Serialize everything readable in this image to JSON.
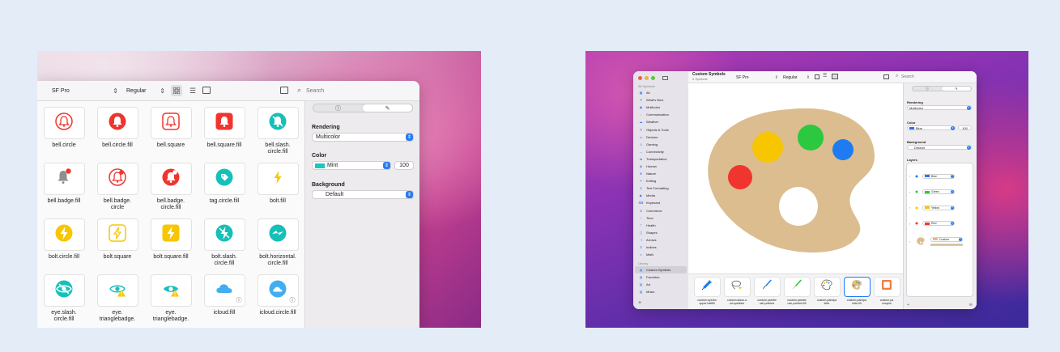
{
  "left_window": {
    "toolbar": {
      "font": "SF Pro",
      "weight": "Regular",
      "search_placeholder": "Search"
    },
    "symbols": [
      {
        "name": "bell.circle",
        "icon": "bell-circle-icon",
        "color": "#f0352e"
      },
      {
        "name": "bell.circle.fill",
        "icon": "bell-circle-fill-icon",
        "color": "#f0352e"
      },
      {
        "name": "bell.square",
        "icon": "bell-square-icon",
        "color": "#f0352e"
      },
      {
        "name": "bell.square.fill",
        "icon": "bell-square-fill-icon",
        "color": "#f0352e"
      },
      {
        "name": "bell.slash.\ncircle.fill",
        "icon": "bell-slash-circle-fill-icon",
        "color": "#16c0b8"
      },
      {
        "name": "bell.badge.fill",
        "icon": "bell-badge-fill-icon",
        "color": "#8e8e93"
      },
      {
        "name": "bell.badge.\ncircle",
        "icon": "bell-badge-circle-icon",
        "color": "#f0352e"
      },
      {
        "name": "bell.badge.\ncircle.fill",
        "icon": "bell-badge-circle-fill-icon",
        "color": "#f0352e"
      },
      {
        "name": "tag.circle.fill",
        "icon": "tag-circle-fill-icon",
        "color": "#16c0b8"
      },
      {
        "name": "bolt.fill",
        "icon": "bolt-fill-icon",
        "color": "#f7c600"
      },
      {
        "name": "bolt.circle.fill",
        "icon": "bolt-circle-fill-icon",
        "color": "#f7c600"
      },
      {
        "name": "bolt.square",
        "icon": "bolt-square-icon",
        "color": "#f7c600"
      },
      {
        "name": "bolt.square.fill",
        "icon": "bolt-square-fill-icon",
        "color": "#f7c600"
      },
      {
        "name": "bolt.slash.\ncircle.fill",
        "icon": "bolt-slash-circle-fill-icon",
        "color": "#16c0b8"
      },
      {
        "name": "bolt.horizontal.\ncircle.fill",
        "icon": "bolt-horizontal-circle-fill-icon",
        "color": "#16c0b8"
      },
      {
        "name": "eye.slash.\ncircle.fill",
        "icon": "eye-slash-circle-fill-icon",
        "color": "#16c0b8"
      },
      {
        "name": "eye.\ntrianglebadge.",
        "icon": "eye-trianglebadge-icon",
        "color": "#16c0b8"
      },
      {
        "name": "eye.\ntrianglebadge.",
        "icon": "eye-trianglebadge-fill-icon",
        "color": "#16c0b8"
      },
      {
        "name": "icloud.fill",
        "icon": "icloud-fill-icon",
        "color": "#42aef0"
      },
      {
        "name": "icloud.circle.fill",
        "icon": "icloud-circle-fill-icon",
        "color": "#42aef0"
      }
    ],
    "inspector": {
      "rendering_label": "Rendering",
      "rendering_value": "Multicolor",
      "color_label": "Color",
      "color_value": "Mint",
      "color_swatch": "#1cc5be",
      "opacity_value": "100",
      "background_label": "Background",
      "background_value": "Default"
    }
  },
  "right_window": {
    "title": "Custom Symbols",
    "subtitle": "6 Symbols",
    "toolbar": {
      "font": "SF Pro",
      "weight": "Regular",
      "search_placeholder": "Search"
    },
    "sidebar": {
      "section1": "All Symbols",
      "items": [
        "All",
        "What's New",
        "Multicolor",
        "Communication",
        "Weather",
        "Objects & Tools",
        "Devices",
        "Gaming",
        "Connectivity",
        "Transportation",
        "Human",
        "Nature",
        "Editing",
        "Text Formatting",
        "Media",
        "Keyboard",
        "Commerce",
        "Time",
        "Health",
        "Shapes",
        "Arrows",
        "Indices",
        "Math"
      ],
      "section2": "Library",
      "library": [
        "Custom Symbols",
        "Favorites",
        "Art",
        "Music"
      ]
    },
    "palette_colors": {
      "body": "#dbbd8f",
      "yellow": "#f7c600",
      "green": "#2cc840",
      "blue": "#1e7bf2",
      "red": "#f0352e"
    },
    "strip": [
      {
        "name": "custom.eyedro\nopper.halffill",
        "icon": "eyedropper-icon"
      },
      {
        "name": "custom.lasso.a\nnd.sparkles",
        "icon": "lasso-sparkles-icon"
      },
      {
        "name": "custom.paintbr\nush.pointed",
        "icon": "paintbrush-pointed-icon"
      },
      {
        "name": "custom.paintbr\nush.pointed.fill",
        "icon": "paintbrush-pointed-fill-icon"
      },
      {
        "name": "custom.paintpa\nlette",
        "icon": "paintpalette-icon"
      },
      {
        "name": "custom.paintpa\nlette.fill",
        "icon": "paintpalette-fill-icon"
      },
      {
        "name": "custom.pa\ncroquis",
        "icon": "croquis-icon"
      }
    ],
    "inspector": {
      "rendering_label": "Rendering",
      "rendering_value": "Multicolor",
      "color_label": "Color",
      "color_value": "Blue",
      "opacity_value": "100",
      "background_label": "Background",
      "background_value": "Default",
      "layers_label": "Layers",
      "layers": [
        {
          "name": "Blue",
          "color": "#1e7bf2"
        },
        {
          "name": "Green",
          "color": "#2cc840"
        },
        {
          "name": "Yellow",
          "color": "#f7c600"
        },
        {
          "name": "Red",
          "color": "#f0352e"
        },
        {
          "name": "Custom",
          "color": "#dbbd8f"
        }
      ]
    }
  }
}
